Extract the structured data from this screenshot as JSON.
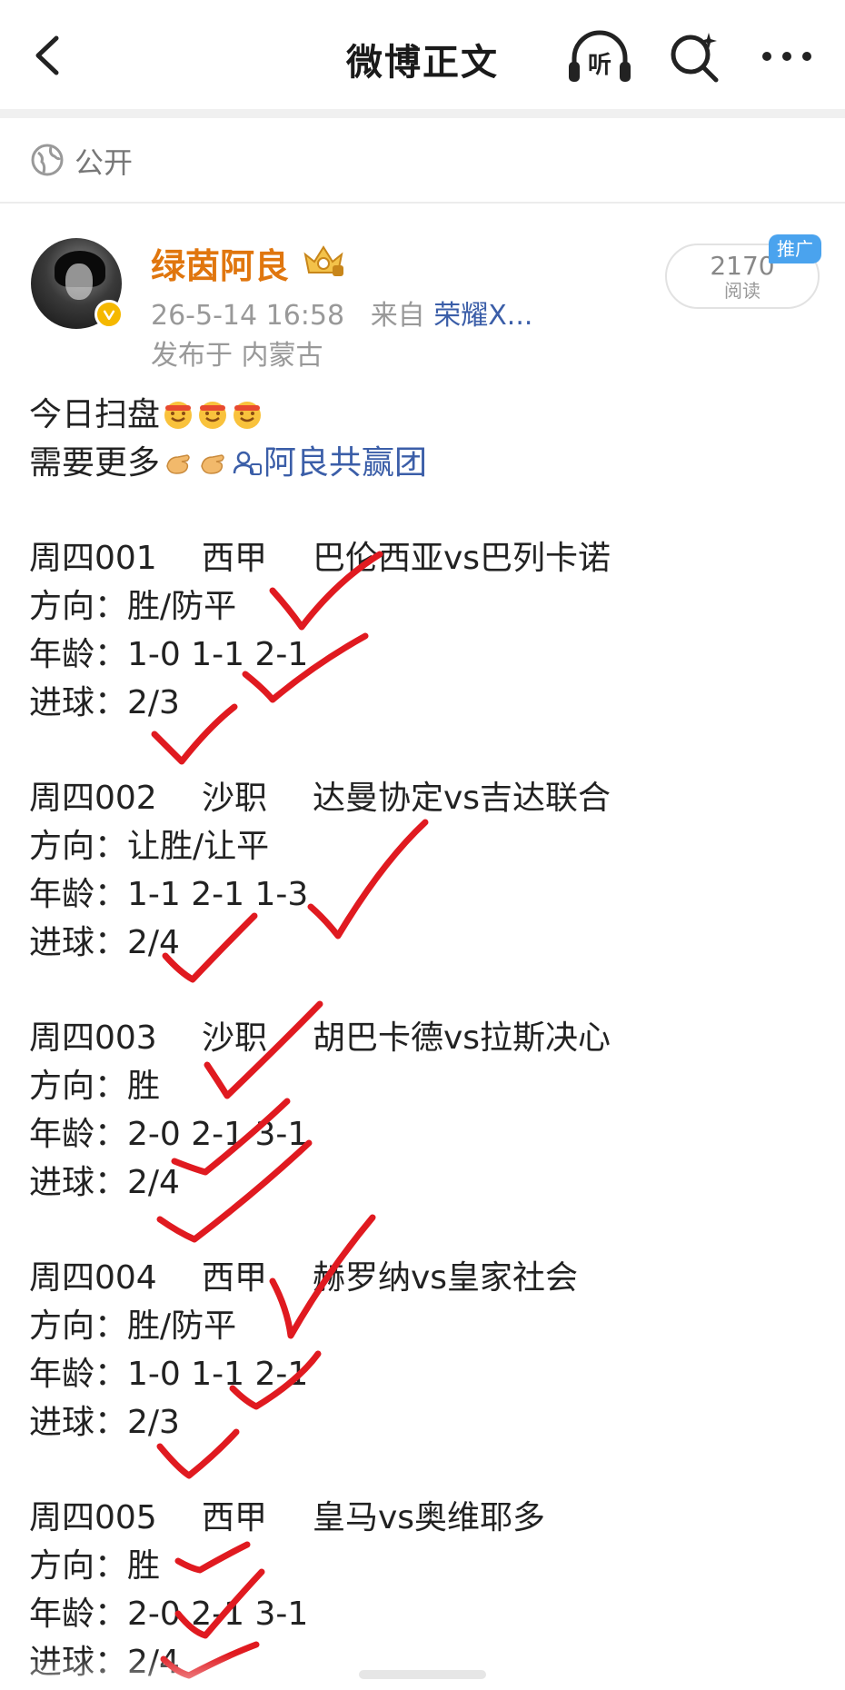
{
  "header": {
    "title": "微博正文",
    "listen_label": "听"
  },
  "visibility": {
    "label": "公开"
  },
  "author": {
    "name": "绿茵阿良",
    "time": "26-5-14 16:58",
    "from_prefix": "来自",
    "device": "荣耀X...",
    "location": "发布于 内蒙古"
  },
  "reads": {
    "count": "2170",
    "label": "阅读",
    "promo": "推广"
  },
  "post": {
    "intro1": "今日扫盘",
    "intro2": "需要更多",
    "group_link": "阿良共赢团",
    "matches": [
      {
        "code": "周四001",
        "league": "西甲",
        "teams": "巴伦西亚vs巴列卡诺",
        "direction": "方向：胜/防平",
        "age": "年龄：1-0 1-1 2-1",
        "goals": "进球：2/3"
      },
      {
        "code": "周四002",
        "league": "沙职",
        "teams": "达曼协定vs吉达联合",
        "direction": "方向：让胜/让平",
        "age": "年龄：1-1 2-1 1-3",
        "goals": "进球：2/4"
      },
      {
        "code": "周四003",
        "league": "沙职",
        "teams": "胡巴卡德vs拉斯决心",
        "direction": "方向：胜",
        "age": "年龄：2-0 2-1 3-1",
        "goals": "进球：2/4"
      },
      {
        "code": "周四004",
        "league": "西甲",
        "teams": "赫罗纳vs皇家社会",
        "direction": "方向：胜/防平",
        "age": "年龄：1-0 1-1 2-1",
        "goals": "进球：2/3"
      },
      {
        "code": "周四005",
        "league": "西甲",
        "teams": "皇马vs奥维耶多",
        "direction": "方向：胜",
        "age": "年龄：2-0 2-1 3-1",
        "goals": "进球：2/4"
      }
    ]
  },
  "colors": {
    "accent_name": "#e0760e",
    "link": "#3b5ea8",
    "check_mark": "#e01a20",
    "promo": "#4aa3ee",
    "vip": "#f5b800"
  },
  "icons": [
    "back-arrow-icon",
    "listen-icon",
    "ai-search-icon",
    "more-icon",
    "globe-icon",
    "crown-badge-icon",
    "verified-icon",
    "emoji-icon",
    "group-icon"
  ]
}
